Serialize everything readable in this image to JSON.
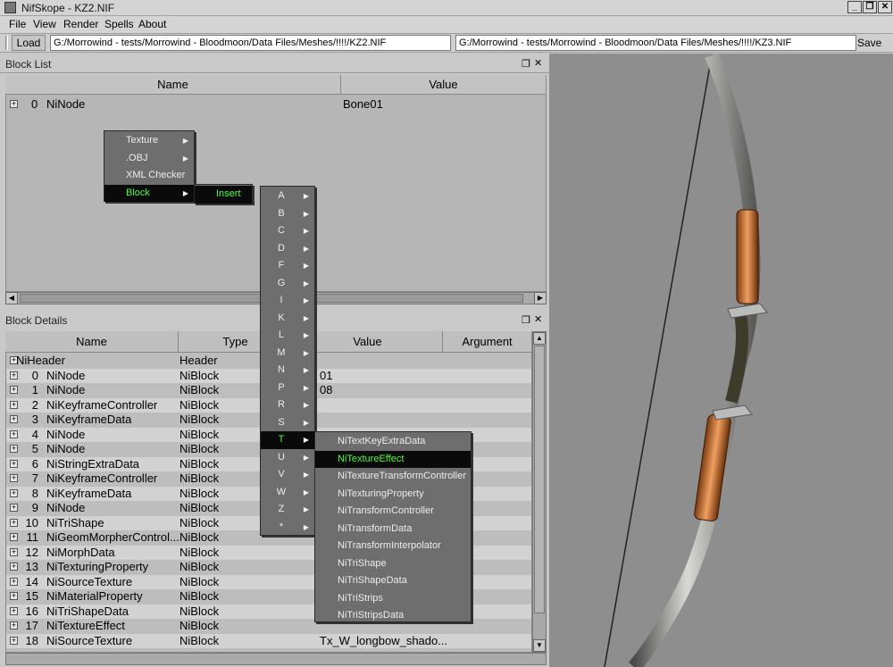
{
  "window": {
    "title": "NifSkope - KZ2.NIF",
    "controls": {
      "minimize": "_",
      "restore": "❐",
      "close": "✕"
    }
  },
  "menubar": [
    "File",
    "View",
    "Render",
    "Spells",
    "About"
  ],
  "toolbar": {
    "load_label": "Load",
    "path_left": "G:/Morrowind - tests/Morrowind - Bloodmoon/Data Files/Meshes/!!!!/KZ2.NIF",
    "path_right": "G:/Morrowind - tests/Morrowind - Bloodmoon/Data Files/Meshes/!!!!/KZ3.NIF",
    "save_label": "Save"
  },
  "block_list": {
    "title": "Block List",
    "columns": {
      "name": "Name",
      "value": "Value"
    },
    "rows": [
      {
        "index": "0",
        "name": "NiNode",
        "value": "Bone01"
      }
    ]
  },
  "block_details": {
    "title": "Block Details",
    "columns": {
      "name": "Name",
      "type": "Type",
      "value": "Value",
      "argument": "Argument"
    },
    "rows": [
      {
        "index": "",
        "name": "NiHeader",
        "type": "Header",
        "value": ""
      },
      {
        "index": "0",
        "name": "NiNode",
        "type": "NiBlock",
        "value": "01"
      },
      {
        "index": "1",
        "name": "NiNode",
        "type": "NiBlock",
        "value": "08"
      },
      {
        "index": "2",
        "name": "NiKeyframeController",
        "type": "NiBlock",
        "value": ""
      },
      {
        "index": "3",
        "name": "NiKeyframeData",
        "type": "NiBlock",
        "value": ""
      },
      {
        "index": "4",
        "name": "NiNode",
        "type": "NiBlock",
        "value": ""
      },
      {
        "index": "5",
        "name": "NiNode",
        "type": "NiBlock",
        "value": ""
      },
      {
        "index": "6",
        "name": "NiStringExtraData",
        "type": "NiBlock",
        "value": ""
      },
      {
        "index": "7",
        "name": "NiKeyframeController",
        "type": "NiBlock",
        "value": ""
      },
      {
        "index": "8",
        "name": "NiKeyframeData",
        "type": "NiBlock",
        "value": ""
      },
      {
        "index": "9",
        "name": "NiNode",
        "type": "NiBlock",
        "value": ""
      },
      {
        "index": "10",
        "name": "NiTriShape",
        "type": "NiBlock",
        "value": ""
      },
      {
        "index": "11",
        "name": "NiGeomMorpherControl...",
        "type": "NiBlock",
        "value": ""
      },
      {
        "index": "12",
        "name": "NiMorphData",
        "type": "NiBlock",
        "value": ""
      },
      {
        "index": "13",
        "name": "NiTexturingProperty",
        "type": "NiBlock",
        "value": ""
      },
      {
        "index": "14",
        "name": "NiSourceTexture",
        "type": "NiBlock",
        "value": ""
      },
      {
        "index": "15",
        "name": "NiMaterialProperty",
        "type": "NiBlock",
        "value": ""
      },
      {
        "index": "16",
        "name": "NiTriShapeData",
        "type": "NiBlock",
        "value": ""
      },
      {
        "index": "17",
        "name": "NiTextureEffect",
        "type": "NiBlock",
        "value": ""
      },
      {
        "index": "18",
        "name": "NiSourceTexture",
        "type": "NiBlock",
        "value": "Tx_W_longbow_shado..."
      }
    ]
  },
  "context_menu": {
    "main": [
      "Texture",
      ".OBJ",
      "XML Checker",
      "Block"
    ],
    "block_sub": [
      "Insert"
    ],
    "letters": [
      "A",
      "B",
      "C",
      "D",
      "F",
      "G",
      "I",
      "K",
      "L",
      "M",
      "N",
      "P",
      "R",
      "S",
      "T",
      "U",
      "V",
      "W",
      "Z",
      "*"
    ],
    "t_items": [
      "NiTextKeyExtraData",
      "NiTextureEffect",
      "NiTextureTransformController",
      "NiTexturingProperty",
      "NiTransformController",
      "NiTransformData",
      "NiTransformInterpolator",
      "NiTriShape",
      "NiTriShapeData",
      "NiTriStrips",
      "NiTriStripsData"
    ],
    "highlighted": {
      "main": "Block",
      "letter": "T",
      "t_item": "NiTextureEffect"
    }
  },
  "colors": {
    "highlight_text": "#4cff3c",
    "menu_bg": "#6e6e6e",
    "viewport_bg": "#8e8e8e"
  }
}
